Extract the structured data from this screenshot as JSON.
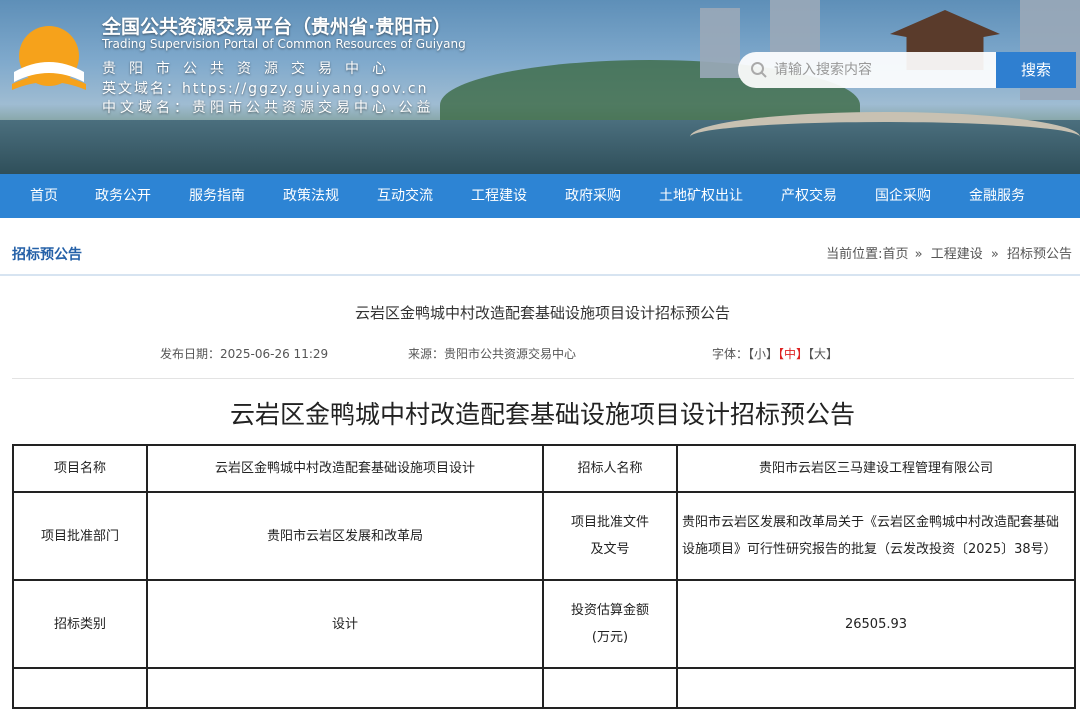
{
  "header": {
    "title": "全国公共资源交易平台（贵州省·贵阳市）",
    "subtitle": "Trading Supervision Portal of Common Resources of Guiyang",
    "center_name": "贵阳市公共资源交易中心",
    "en_domain": "英文域名：https://ggzy.guiyang.gov.cn",
    "cn_domain": "中文域名：贵阳市公共资源交易中心.公益",
    "search_placeholder": "请输入搜索内容",
    "search_button": "搜索"
  },
  "nav": [
    "首页",
    "政务公开",
    "服务指南",
    "政策法规",
    "互动交流",
    "工程建设",
    "政府采购",
    "土地矿权出让",
    "产权交易",
    "国企采购",
    "金融服务"
  ],
  "section": {
    "title": "招标预公告",
    "breadcrumb_prefix": "当前位置:",
    "breadcrumb": [
      "首页",
      "工程建设",
      "招标预公告"
    ],
    "separator": "»"
  },
  "article": {
    "title": "云岩区金鸭城中村改造配套基础设施项目设计招标预公告",
    "publish": "发布日期：2025-06-26 11:29",
    "source": "来源：贵阳市公共资源交易中心",
    "font_label": "字体：",
    "font_small": "【小】",
    "font_medium": "【中】",
    "font_large": "【大】",
    "heading": "云岩区金鸭城中村改造配套基础设施项目设计招标预公告"
  },
  "table": {
    "rows": [
      [
        "项目名称",
        "云岩区金鸭城中村改造配套基础设施项目设计",
        "招标人名称",
        "贵阳市云岩区三马建设工程管理有限公司"
      ],
      [
        "项目批准部门",
        "贵阳市云岩区发展和改革局",
        "项目批准文件及文号",
        "贵阳市云岩区发展和改革局关于《云岩区金鸭城中村改造配套基础设施项目》可行性研究报告的批复（云发改投资〔2025〕38号）"
      ],
      [
        "招标类别",
        "设计",
        "投资估算金额(万元)",
        "26505.93"
      ]
    ]
  },
  "colors": {
    "nav_bg": "#2d84d4",
    "accent": "#2561a8",
    "active_font": "#d22222"
  }
}
